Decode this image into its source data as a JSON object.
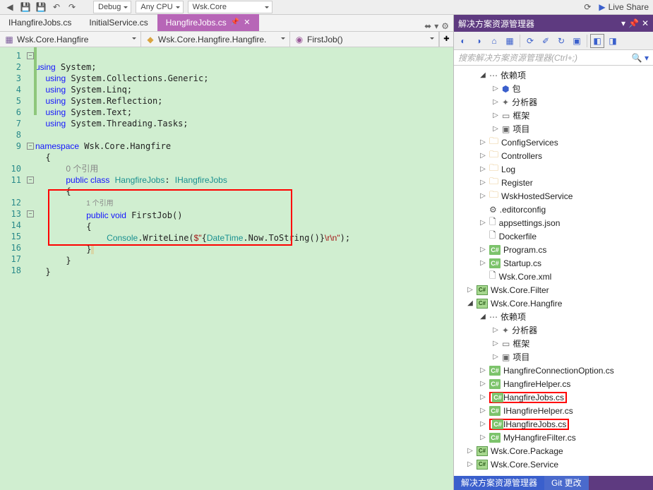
{
  "toolbar": {
    "config": "Debug",
    "platform": "Any CPU",
    "project": "Wsk.Core",
    "liveshare": "Live Share"
  },
  "tabs": [
    {
      "label": "IHangfireJobs.cs"
    },
    {
      "label": "InitialService.cs"
    },
    {
      "label": "HangfireJobs.cs",
      "active": true
    }
  ],
  "nav": {
    "ns": "Wsk.Core.Hangfire",
    "class": "Wsk.Core.Hangfire.Hangfire.",
    "method": "FirstJob()"
  },
  "codeLines": [
    "1",
    "2",
    "3",
    "4",
    "5",
    "6",
    "7",
    "8",
    "9",
    "",
    "10",
    "11",
    "",
    "12",
    "13",
    "14",
    "15",
    "16",
    "17",
    "18"
  ],
  "refsLabel": "0 个引用",
  "refsLabel2": "1 个引用",
  "explorer": {
    "title": "解决方案资源管理器",
    "searchPlaceholder": "搜索解决方案资源管理器(Ctrl+;)",
    "items": [
      {
        "depth": 1,
        "arrow": "open",
        "icon": "deps",
        "label": "依赖项"
      },
      {
        "depth": 2,
        "arrow": "right",
        "icon": "pkg",
        "label": "包"
      },
      {
        "depth": 2,
        "arrow": "right",
        "icon": "anal",
        "label": "分析器"
      },
      {
        "depth": 2,
        "arrow": "right",
        "icon": "frame",
        "label": "框架"
      },
      {
        "depth": 2,
        "arrow": "right",
        "icon": "proj",
        "label": "项目"
      },
      {
        "depth": 1,
        "arrow": "right",
        "icon": "folder",
        "label": "ConfigServices"
      },
      {
        "depth": 1,
        "arrow": "right",
        "icon": "folder",
        "label": "Controllers"
      },
      {
        "depth": 1,
        "arrow": "right",
        "icon": "folder",
        "label": "Log"
      },
      {
        "depth": 1,
        "arrow": "right",
        "icon": "folder",
        "label": "Register"
      },
      {
        "depth": 1,
        "arrow": "right",
        "icon": "folder",
        "label": "WskHostedService"
      },
      {
        "depth": 1,
        "arrow": "none",
        "icon": "cfg",
        "label": ".editorconfig"
      },
      {
        "depth": 1,
        "arrow": "right",
        "icon": "json",
        "label": "appsettings.json"
      },
      {
        "depth": 1,
        "arrow": "none",
        "icon": "file",
        "label": "Dockerfile"
      },
      {
        "depth": 1,
        "arrow": "right",
        "icon": "cs",
        "label": "Program.cs"
      },
      {
        "depth": 1,
        "arrow": "right",
        "icon": "cs",
        "label": "Startup.cs"
      },
      {
        "depth": 1,
        "arrow": "none",
        "icon": "file",
        "label": "Wsk.Core.xml"
      },
      {
        "depth": 0,
        "arrow": "right",
        "icon": "projcs",
        "label": "Wsk.Core.Filter"
      },
      {
        "depth": 0,
        "arrow": "open",
        "icon": "projcs",
        "label": "Wsk.Core.Hangfire"
      },
      {
        "depth": 1,
        "arrow": "open",
        "icon": "deps",
        "label": "依赖项"
      },
      {
        "depth": 2,
        "arrow": "right",
        "icon": "anal",
        "label": "分析器"
      },
      {
        "depth": 2,
        "arrow": "right",
        "icon": "frame",
        "label": "框架"
      },
      {
        "depth": 2,
        "arrow": "right",
        "icon": "proj",
        "label": "项目"
      },
      {
        "depth": 1,
        "arrow": "right",
        "icon": "cs",
        "label": "HangfireConnectionOption.cs"
      },
      {
        "depth": 1,
        "arrow": "right",
        "icon": "cs",
        "label": "HangfireHelper.cs"
      },
      {
        "depth": 1,
        "arrow": "right",
        "icon": "cs",
        "label": "HangfireJobs.cs",
        "red": true
      },
      {
        "depth": 1,
        "arrow": "right",
        "icon": "cs",
        "label": "IHangfireHelper.cs"
      },
      {
        "depth": 1,
        "arrow": "right",
        "icon": "cs",
        "label": "IHangfireJobs.cs",
        "red": true
      },
      {
        "depth": 1,
        "arrow": "right",
        "icon": "cs",
        "label": "MyHangfireFilter.cs"
      },
      {
        "depth": 0,
        "arrow": "right",
        "icon": "projcs",
        "label": "Wsk.Core.Package"
      },
      {
        "depth": 0,
        "arrow": "right",
        "icon": "projcs",
        "label": "Wsk.Core.Service"
      }
    ]
  },
  "status": {
    "left": "解决方案资源管理器",
    "right": "Git 更改"
  }
}
